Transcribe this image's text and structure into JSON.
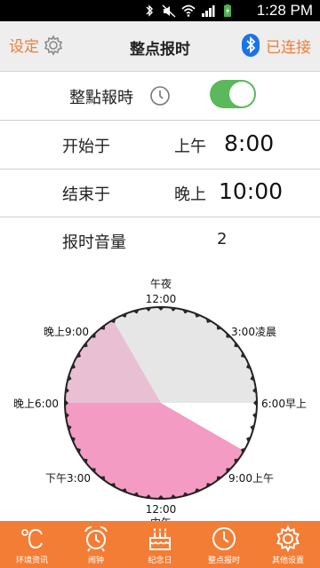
{
  "status_bar": {
    "time": "1:28 PM"
  },
  "header": {
    "settings_label": "设定",
    "title": "整点报时",
    "connect_label": "已连接"
  },
  "chime_toggle": {
    "label": "整點報時",
    "enabled": true
  },
  "start_row": {
    "label": "开始于",
    "period": "上午",
    "time": "8:00"
  },
  "end_row": {
    "label": "结束于",
    "period": "晚上",
    "time": "10:00"
  },
  "volume_row": {
    "label": "报时音量",
    "value": "2"
  },
  "dial": {
    "label_top_word": "午夜",
    "label_top_time": "12:00",
    "label_upper_right": "3:00凌晨",
    "label_right": "6:00早上",
    "label_lower_right": "9:00上午",
    "label_bottom_time": "12:00",
    "label_bottom_word": "中午",
    "label_lower_left": "下午3:00",
    "label_left": "晚上6:00",
    "label_upper_left": "晚上9:00",
    "colors": {
      "background": "#e6e6e6",
      "active_range": "#f39bc3",
      "evening_range": "#e9bfd4",
      "gap": "#ffffff",
      "ring": "#222222"
    }
  },
  "nav": {
    "items": [
      {
        "label": "环境资讯",
        "icon": "thermometer-celsius-icon"
      },
      {
        "label": "闹钟",
        "icon": "alarm-clock-icon"
      },
      {
        "label": "纪念日",
        "icon": "cake-icon"
      },
      {
        "label": "整点报时",
        "icon": "clock-icon"
      },
      {
        "label": "其他设置",
        "icon": "gear-icon"
      }
    ],
    "active_index": 3
  }
}
